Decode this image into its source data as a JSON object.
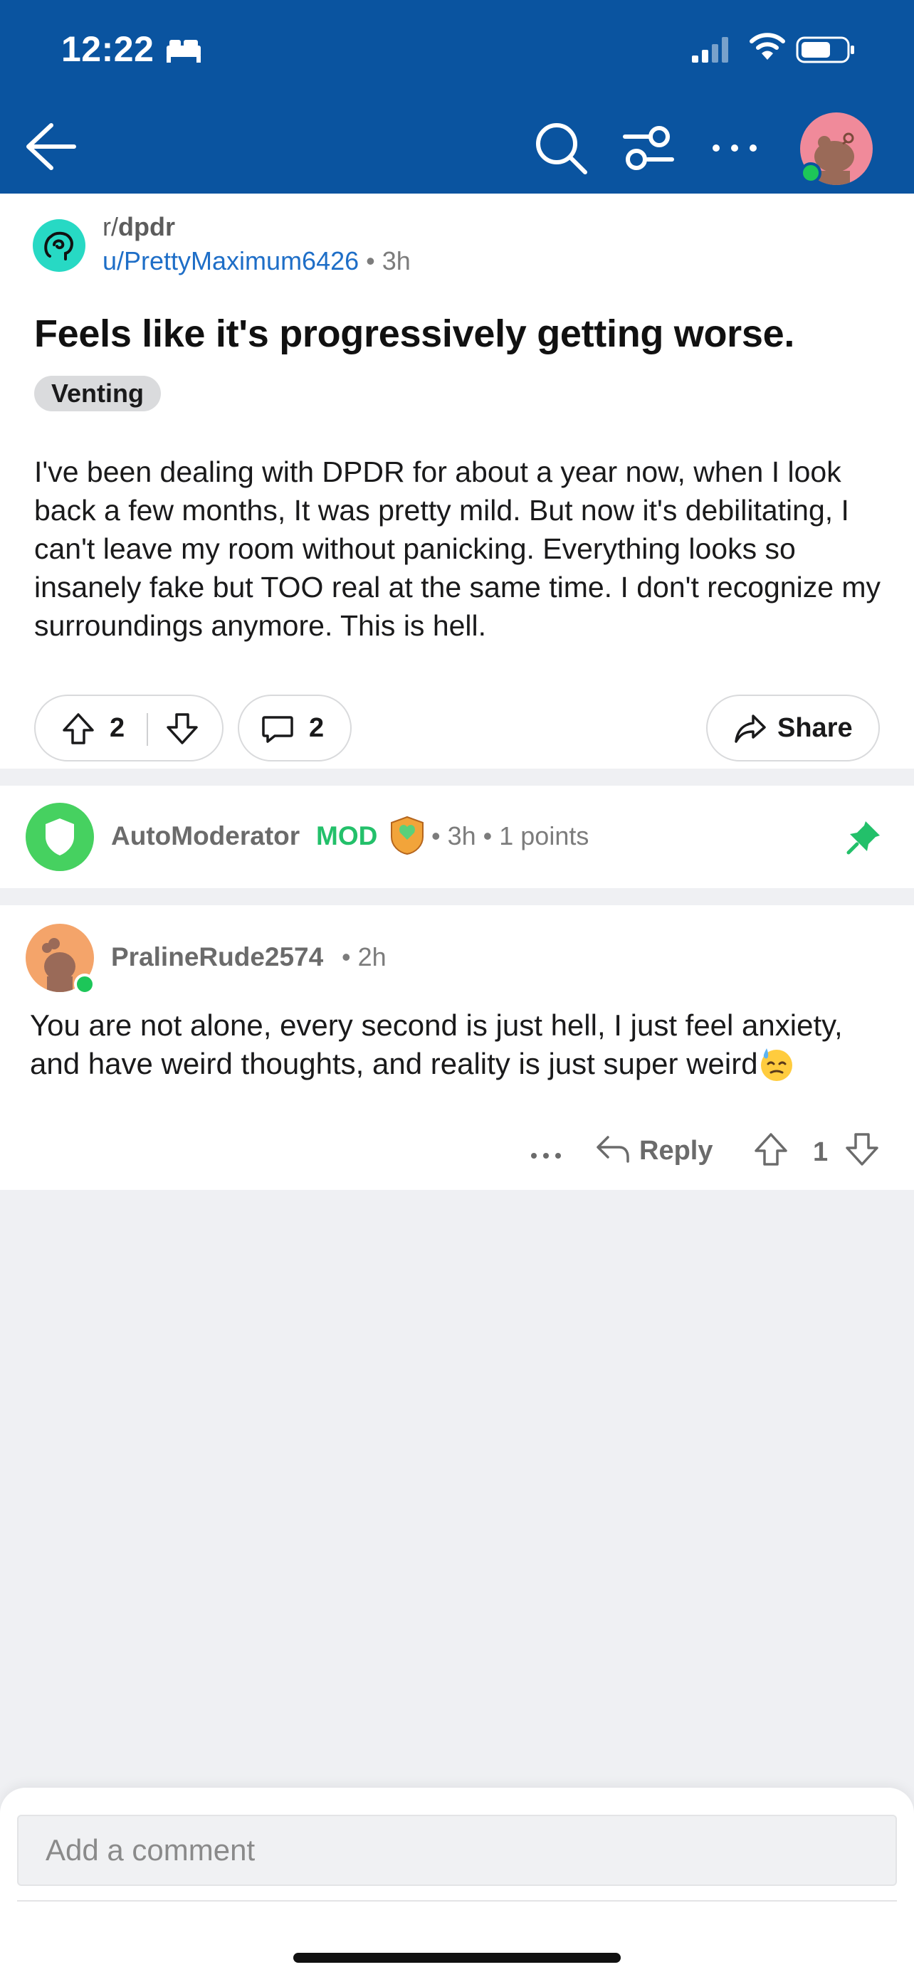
{
  "status_bar": {
    "time": "12:22"
  },
  "nav": {
    "back": "back",
    "search": "search",
    "filter": "filter",
    "more": "more"
  },
  "post": {
    "subreddit_prefix": "r/",
    "subreddit": "dpdr",
    "author": "u/PrettyMaximum6426",
    "separator": "•",
    "age": "3h",
    "title": "Feels like it's progressively getting worse.",
    "flair": "Venting",
    "body": "I've been dealing with DPDR for about a year now, when I look back a few months, It was pretty mild. But now it's debilitating, I can't leave my room without panicking. Everything looks so insanely fake but TOO real at the same time. I don't recognize my surroundings anymore. This is hell.",
    "votes": "2",
    "comments": "2",
    "share_label": "Share"
  },
  "mod_comment": {
    "author": "AutoModerator",
    "tag": "MOD",
    "meta": "• 3h • 1 points"
  },
  "comment": {
    "author": "PralineRude2574",
    "meta": "• 2h",
    "body": "You are not alone, every second is just hell, I just feel anxiety, and have weird thoughts, and reality is just super weird",
    "reply_label": "Reply",
    "score": "1"
  },
  "composer": {
    "placeholder": "Add a comment"
  },
  "colors": {
    "header_bg": "#0a54a0",
    "link": "#1e6ec7",
    "mod_green": "#23c06a",
    "online_green": "#1dc659",
    "page_bg": "#eff0f3"
  },
  "icons": {
    "back": "arrow-left-icon",
    "search": "search-icon",
    "filter": "sliders-icon",
    "more": "ellipsis-icon",
    "upvote": "arrow-up-icon",
    "downvote": "arrow-down-icon",
    "comment": "speech-bubble-icon",
    "share": "share-arrow-icon",
    "pin": "pin-icon",
    "reply": "reply-arrow-icon"
  }
}
